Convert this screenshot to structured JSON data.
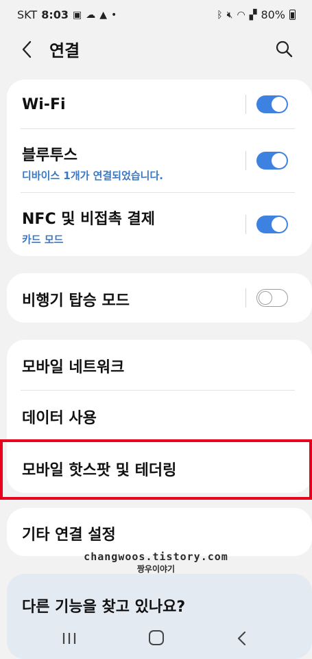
{
  "status_bar": {
    "carrier": "SKT",
    "time": "8:03",
    "battery": "80%",
    "left_icons": [
      "image-icon",
      "cloud-icon",
      "warning-icon",
      "dot-icon"
    ],
    "right_icons": [
      "bluetooth-icon",
      "mute-icon",
      "wifi-icon",
      "signal-icon",
      "battery-icon"
    ]
  },
  "header": {
    "title": "연결"
  },
  "group1": {
    "wifi": {
      "label": "Wi-Fi",
      "toggle": "on"
    },
    "bluetooth": {
      "label": "블루투스",
      "sub": "디바이스 1개가 연결되었습니다.",
      "toggle": "on"
    },
    "nfc": {
      "label": "NFC 및 비접촉 결제",
      "sub": "카드 모드",
      "toggle": "on"
    }
  },
  "group2": {
    "airplane": {
      "label": "비행기 탑승 모드",
      "toggle": "off"
    }
  },
  "group3": {
    "mobile_network": "모바일 네트워크",
    "data_usage": "데이터 사용",
    "hotspot": "모바일 핫스팟 및 테더링"
  },
  "group4": {
    "more": "기타 연결 설정"
  },
  "watermark": {
    "line1": "changwoos.tistory.com",
    "line2": "짱우이야기"
  },
  "suggestion": {
    "label": "다른 기능을 찾고 있나요?"
  },
  "colors": {
    "accent": "#3e82e1",
    "sub_text": "#3b78c2",
    "highlight": "#e8001a"
  }
}
